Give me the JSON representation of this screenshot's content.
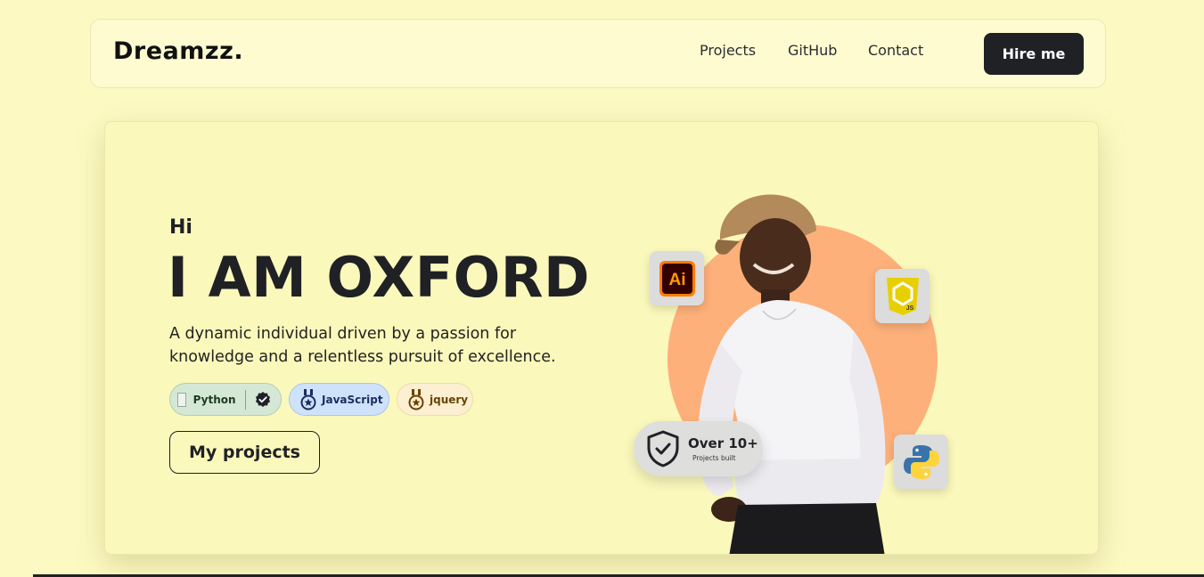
{
  "nav": {
    "brand": "Dreamzz.",
    "links": [
      "Projects",
      "GitHub",
      "Contact"
    ],
    "cta": "Hire me"
  },
  "hero": {
    "greeting": "Hi",
    "headline": "I AM OXFORD",
    "tagline": "A dynamic individual driven by a passion for knowledge and a relentless pursuit of excellence.",
    "badges": [
      {
        "label": "Python",
        "icon": "check-circle-icon",
        "color": "#d5e8d6"
      },
      {
        "label": "JavaScript",
        "icon": "medal-icon",
        "color": "#cfe2fb"
      },
      {
        "label": "jquery",
        "icon": "medal-icon",
        "color": "#fcefd2"
      }
    ],
    "projects_button": "My projects"
  },
  "portrait": {
    "orb_color": "#fdb07a",
    "floating_icons": [
      "adobe-illustrator-icon",
      "javascript-icon",
      "python-icon"
    ],
    "stat": {
      "title": "Over 10+",
      "subtitle": "Projects built"
    }
  },
  "colors": {
    "background": "#fcf9c2",
    "dark": "#1f2125"
  }
}
